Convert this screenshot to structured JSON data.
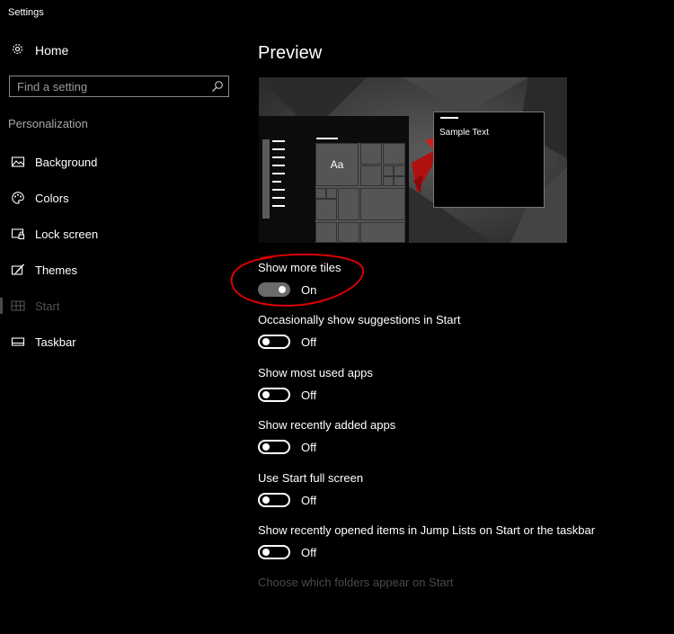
{
  "window": {
    "title": "Settings"
  },
  "sidebar": {
    "home_label": "Home",
    "search_placeholder": "Find a setting",
    "section_title": "Personalization",
    "items": [
      {
        "label": "Background",
        "icon": "picture-icon"
      },
      {
        "label": "Colors",
        "icon": "palette-icon"
      },
      {
        "label": "Lock screen",
        "icon": "lock-screen-icon"
      },
      {
        "label": "Themes",
        "icon": "brush-icon"
      },
      {
        "label": "Start",
        "icon": "start-tiles-icon",
        "active": true
      },
      {
        "label": "Taskbar",
        "icon": "taskbar-icon"
      }
    ]
  },
  "main": {
    "preview_title": "Preview",
    "preview_tile_label": "Aa",
    "preview_sample_text": "Sample Text",
    "settings": [
      {
        "label": "Show more tiles",
        "state": "On"
      },
      {
        "label": "Occasionally show suggestions in Start",
        "state": "Off"
      },
      {
        "label": "Show most used apps",
        "state": "Off"
      },
      {
        "label": "Show recently added apps",
        "state": "Off"
      },
      {
        "label": "Use Start full screen",
        "state": "Off"
      },
      {
        "label": "Show recently opened items in Jump Lists on Start or the taskbar",
        "state": "Off"
      }
    ],
    "folders_link": "Choose which folders appear on Start"
  },
  "colors": {
    "background": "#000000",
    "disabled_text": "#4a4a4a",
    "annotation": "#d90000"
  }
}
